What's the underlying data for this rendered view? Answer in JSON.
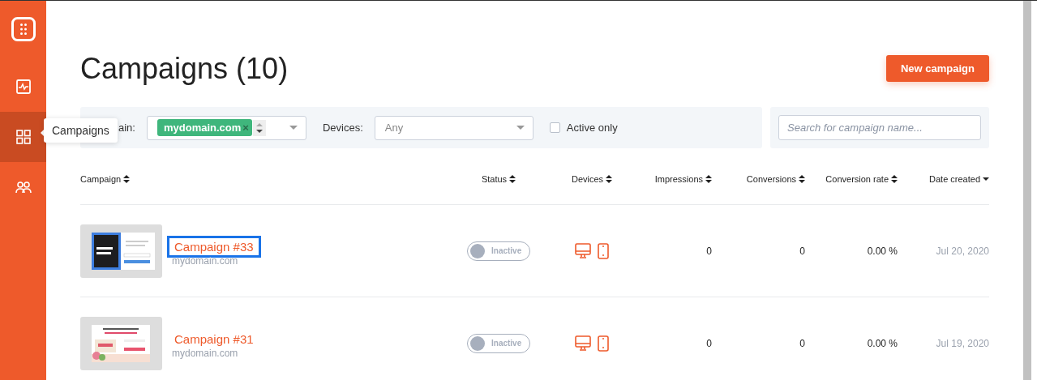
{
  "sidebar": {
    "items": [
      {
        "kind": "activity",
        "selected": false
      },
      {
        "kind": "grid",
        "selected": true
      },
      {
        "kind": "users",
        "selected": false
      }
    ],
    "tooltip": "Campaigns"
  },
  "page": {
    "title": "Campaigns (10)",
    "new_button": "New campaign"
  },
  "filters": {
    "domain_label": "ain:",
    "domain_tags": [
      {
        "label": "mydomain.com",
        "remove": "×"
      }
    ],
    "devices_label": "Devices:",
    "devices_placeholder": "Any",
    "active_only": {
      "label": "Active only",
      "checked": false
    },
    "search": {
      "placeholder": "Search for campaign name..."
    }
  },
  "table": {
    "columns": [
      {
        "label": "Campaign",
        "kind": "sortable"
      },
      {
        "label": "Status",
        "kind": "sortable"
      },
      {
        "label": "Devices",
        "kind": "sortable"
      },
      {
        "label": "Impressions",
        "kind": "sortable"
      },
      {
        "label": "Conversions",
        "kind": "sortable"
      },
      {
        "label": "Conversion rate",
        "kind": "sortable"
      },
      {
        "label": "Date created",
        "kind": "sorted"
      }
    ],
    "rows": [
      {
        "name": "Campaign #33",
        "domain": "mydomain.com",
        "focused": true,
        "status": {
          "label": "Inactive",
          "on": false
        },
        "devices": [
          {
            "kind": "desktop"
          },
          {
            "kind": "mobile"
          }
        ],
        "impressions": "0",
        "conversions": "0",
        "rate": "0.00 %",
        "date": "Jul 20, 2020"
      },
      {
        "name": "Campaign #31",
        "domain": "mydomain.com",
        "focused": false,
        "status": {
          "label": "Inactive",
          "on": false
        },
        "devices": [
          {
            "kind": "desktop"
          },
          {
            "kind": "mobile"
          }
        ],
        "impressions": "0",
        "conversions": "0",
        "rate": "0.00 %",
        "date": "Jul 19, 2020"
      }
    ]
  }
}
